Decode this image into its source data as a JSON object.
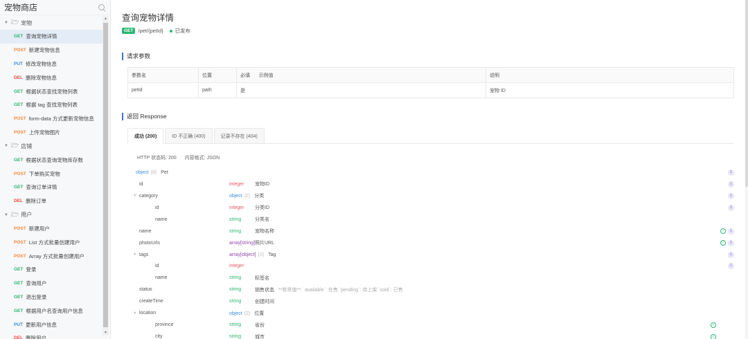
{
  "sidebar": {
    "title": "宠物商店",
    "search_icon": "search-icon",
    "groups": [
      {
        "label": "宠物",
        "items": [
          {
            "method": "GET",
            "label": "查询宠物详情",
            "active": true
          },
          {
            "method": "POST",
            "label": "新建宠物信息"
          },
          {
            "method": "PUT",
            "label": "修改宠物信息"
          },
          {
            "method": "DEL",
            "label": "删除宠物信息"
          },
          {
            "method": "GET",
            "label": "根据状态查找宠物列表"
          },
          {
            "method": "GET",
            "label": "根据 tag 查找宠物列表"
          },
          {
            "method": "POST",
            "label": "form-data 方式更新宠物信息"
          },
          {
            "method": "POST",
            "label": "上传宠物图片"
          }
        ]
      },
      {
        "label": "店铺",
        "items": [
          {
            "method": "GET",
            "label": "根据状态查询宠物库存数"
          },
          {
            "method": "POST",
            "label": "下单购买宠物"
          },
          {
            "method": "GET",
            "label": "查询订单详情"
          },
          {
            "method": "DEL",
            "label": "删除订单"
          }
        ]
      },
      {
        "label": "用户",
        "items": [
          {
            "method": "POST",
            "label": "新建用户"
          },
          {
            "method": "POST",
            "label": "List 方式批量创建用户"
          },
          {
            "method": "POST",
            "label": "Array 方式批量创建用户"
          },
          {
            "method": "GET",
            "label": "登录"
          },
          {
            "method": "GET",
            "label": "查询用户"
          },
          {
            "method": "GET",
            "label": "退出登录"
          },
          {
            "method": "GET",
            "label": "根据用户名查询用户信息"
          },
          {
            "method": "PUT",
            "label": "更新用户信息"
          },
          {
            "method": "DEL",
            "label": "删除用户"
          }
        ]
      }
    ]
  },
  "page": {
    "title": "查询宠物详情",
    "method": "GET",
    "path": "/pet/{petId}",
    "status": "已发布"
  },
  "request": {
    "section_title": "请求参数",
    "headers": [
      "参数名",
      "位置",
      "必填",
      "示例值",
      "说明"
    ],
    "rows": [
      [
        "petId",
        "path",
        "是",
        "",
        "宠物 ID"
      ]
    ]
  },
  "response": {
    "section_title": "返回 Response",
    "tabs": [
      "成功 (200)",
      "ID 不正确 (400)",
      "记录不存在 (404)"
    ],
    "active_tab": 0,
    "status_label": "HTTP 状态码: 200",
    "format_label": "内容格式: JSON",
    "root": {
      "name": "object",
      "count": "{8}",
      "desc": "Pet",
      "badge": "1"
    },
    "fields": [
      {
        "indent": 1,
        "name": "id",
        "type": "integer",
        "tclass": "int",
        "desc": "宠物ID",
        "badge": "1"
      },
      {
        "indent": 1,
        "name": "category",
        "type": "object",
        "tclass": "obj",
        "count": "{2}",
        "desc": "分类",
        "badge": "1",
        "caret": true
      },
      {
        "indent": 2,
        "name": "id",
        "type": "integer",
        "tclass": "int",
        "desc": "分类ID",
        "badge": "1"
      },
      {
        "indent": 2,
        "name": "name",
        "type": "string",
        "tclass": "str",
        "desc": "分类名"
      },
      {
        "indent": 1,
        "name": "name",
        "type": "string",
        "tclass": "str",
        "desc": "宠物名称",
        "badge": "1",
        "check": true
      },
      {
        "indent": 1,
        "name": "photoUrls",
        "type": "array[string]",
        "tclass": "arr",
        "desc": "照片URL",
        "badge": "1",
        "check": true
      },
      {
        "indent": 1,
        "name": "tags",
        "type": "array[object]",
        "tclass": "arr",
        "count": "{2}",
        "desc": "Tag",
        "badge": "1",
        "caret": true
      },
      {
        "indent": 2,
        "name": "id",
        "type": "integer",
        "tclass": "int",
        "desc": "",
        "badge": "1"
      },
      {
        "indent": 2,
        "name": "name",
        "type": "string",
        "tclass": "str",
        "desc": "标签名"
      },
      {
        "indent": 1,
        "name": "status",
        "type": "string",
        "tclass": "str",
        "desc": "销售状态",
        "note": "**枚举值**: `available`: 在售 `pending`: 待上架 `sold`: 已售"
      },
      {
        "indent": 1,
        "name": "createTime",
        "type": "string",
        "tclass": "str",
        "desc": "创建时间"
      },
      {
        "indent": 1,
        "name": "location",
        "type": "object",
        "tclass": "obj",
        "count": "{2}",
        "desc": "位置",
        "caret": true
      },
      {
        "indent": 2,
        "name": "province",
        "type": "string",
        "tclass": "str",
        "desc": "省份",
        "check": true
      },
      {
        "indent": 2,
        "name": "city",
        "type": "string",
        "tclass": "str",
        "desc": "城市",
        "check": true
      }
    ]
  },
  "colors": {
    "get": "#2bb673",
    "post": "#f58a3b",
    "put": "#3c8dde",
    "del": "#f0473e",
    "accent": "#3c6fd8"
  }
}
